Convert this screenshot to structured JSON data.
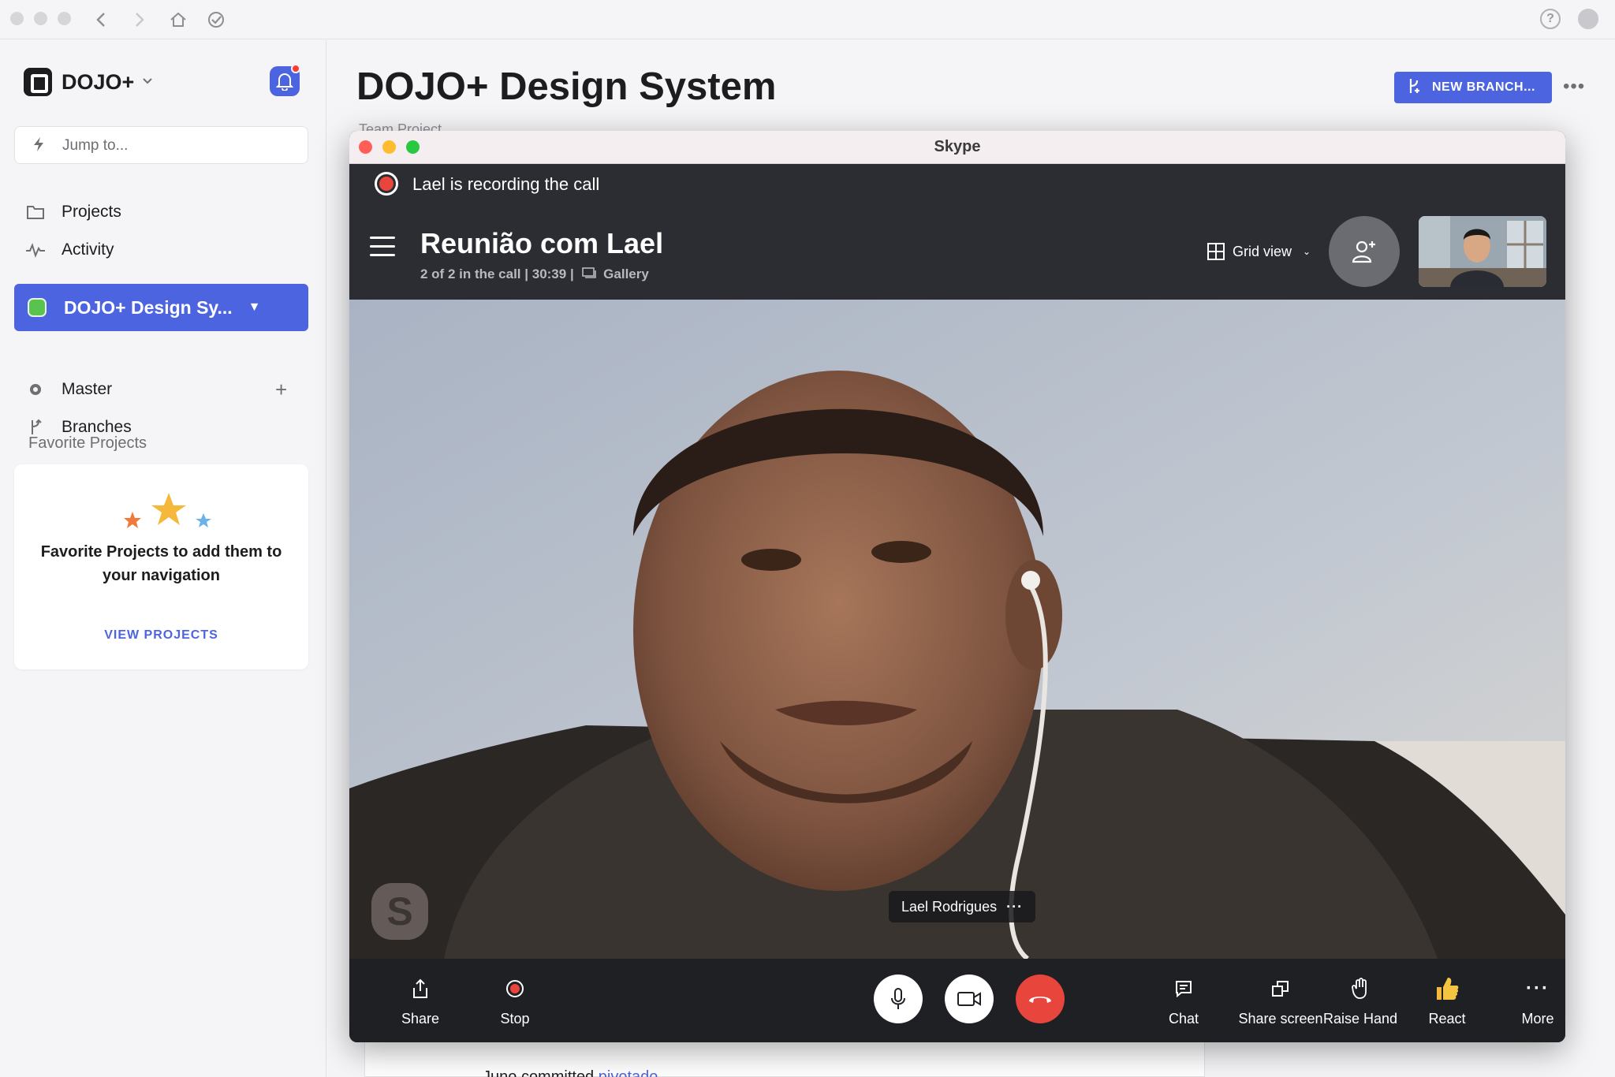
{
  "sidebar": {
    "workspace_name": "DOJO+",
    "search_placeholder": "Jump to...",
    "nav_items": [
      {
        "label": "Projects",
        "icon": "folder-icon"
      },
      {
        "label": "Activity",
        "icon": "activity-icon"
      }
    ],
    "active_project": "DOJO+ Design Sy...",
    "project_items": [
      {
        "label": "Master",
        "icon": "settings-icon"
      },
      {
        "label": "Branches",
        "icon": "branch-icon"
      }
    ],
    "favorites_heading": "Favorite Projects",
    "favorites_empty_text": "Favorite Projects to add them to your navigation",
    "favorites_link": "VIEW PROJECTS"
  },
  "main": {
    "title": "DOJO+ Design System",
    "new_branch_label": "NEW BRANCH...",
    "breadcrumb": "Team Project",
    "activity_user": "Juno",
    "activity_verb": "committed",
    "activity_link": "pivotado"
  },
  "skype": {
    "window_title": "Skype",
    "recording_text": "Lael is recording the call",
    "call_title": "Reunião com Lael",
    "call_status": "2 of 2 in the call | 30:39 |",
    "view_label": "Gallery",
    "grid_view_label": "Grid view",
    "participant_name": "Lael Rodrigues",
    "controls": {
      "share": "Share",
      "stop": "Stop",
      "chat": "Chat",
      "share_screen": "Share screen",
      "raise_hand": "Raise Hand",
      "react": "React",
      "more": "More"
    }
  },
  "colors": {
    "accent": "#4d64e0",
    "record": "#e8453c",
    "hangup": "#e8453c",
    "project_dot": "#5ac24f"
  }
}
